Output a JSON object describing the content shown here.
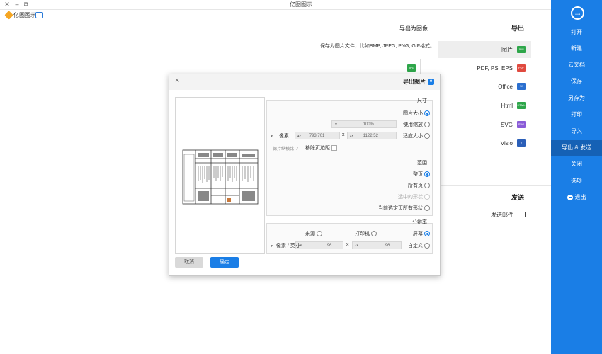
{
  "window": {
    "title": "亿图图示"
  },
  "app": {
    "brand": "亿图图示"
  },
  "sidebar": {
    "items": [
      {
        "label": "打开"
      },
      {
        "label": "新建"
      },
      {
        "label": "云文档"
      },
      {
        "label": "保存"
      },
      {
        "label": "另存为"
      },
      {
        "label": "打印"
      },
      {
        "label": "导入"
      },
      {
        "label": "导出 & 发送"
      },
      {
        "label": "关闭"
      },
      {
        "label": "选项"
      },
      {
        "label": "退出"
      }
    ],
    "active_index": 7
  },
  "export": {
    "heading": "导出",
    "formats": [
      {
        "label": "图片",
        "icon": "JPG",
        "color": "#2ea64a"
      },
      {
        "label": "PDF, PS, EPS",
        "icon": "PDF",
        "color": "#e04a3f"
      },
      {
        "label": "Office",
        "icon": "W",
        "color": "#2b6fcf"
      },
      {
        "label": "Html",
        "icon": "HTML",
        "color": "#2ea64a"
      },
      {
        "label": "SVG",
        "icon": "SVG",
        "color": "#8a5cd8"
      },
      {
        "label": "Visio",
        "icon": "V",
        "color": "#2b5fb8"
      }
    ],
    "send_heading": "发送",
    "send_items": [
      {
        "label": "发送邮件"
      }
    ]
  },
  "main": {
    "title": "导出为图像",
    "description": "保存为图片文件，比如BMP, JPEG, PNG, GIF格式。",
    "jpg_button_icon": "JPG"
  },
  "dialog": {
    "title": "导出图片",
    "size_group": {
      "label": "尺寸",
      "options": [
        {
          "label": "图片大小",
          "checked": true
        },
        {
          "label": "使用缩放",
          "checked": false
        },
        {
          "label": "适应大小",
          "checked": false
        }
      ],
      "zoom_value": "100%",
      "width_value": "1122.52",
      "height_value": "793.701",
      "unit": "像素",
      "times": "x",
      "keep_ratio": "保持纵横比",
      "remove_margin": "移除页边距"
    },
    "range_group": {
      "label": "范围",
      "options": [
        {
          "label": "整页",
          "checked": true,
          "disabled": false
        },
        {
          "label": "所有页",
          "checked": false,
          "disabled": false
        },
        {
          "label": "选中的形状",
          "checked": false,
          "disabled": true
        },
        {
          "label": "当前选定页所有形状",
          "checked": false,
          "disabled": false
        }
      ]
    },
    "resolution_group": {
      "label": "分辨率",
      "options": [
        {
          "label": "屏幕",
          "checked": true
        },
        {
          "label": "打印机",
          "checked": false
        },
        {
          "label": "来源",
          "checked": false
        },
        {
          "label": "自定义",
          "checked": false
        }
      ],
      "x_value": "96",
      "y_value": "96",
      "unit": "像素 / 英寸",
      "times": "x"
    },
    "ok_label": "确定",
    "cancel_label": "取消"
  }
}
